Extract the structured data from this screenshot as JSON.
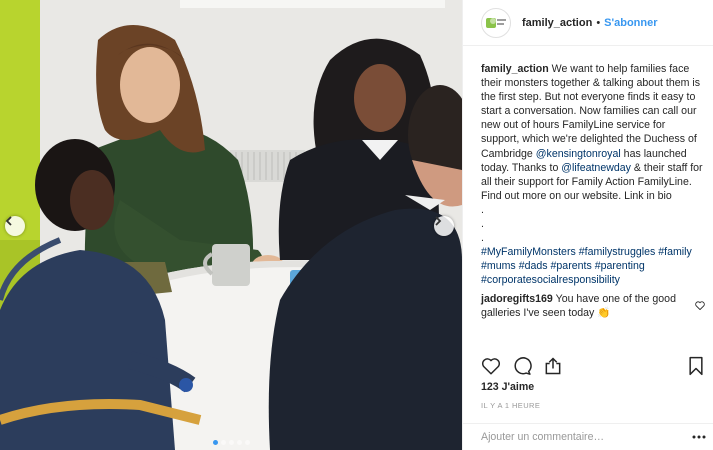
{
  "post": {
    "username": "family_action",
    "separator": "•",
    "follow_label": "S'abonner",
    "caption_author": "family_action",
    "caption_part1": " We want to help families face their monsters together & talking about them is the first step. But not everyone finds it easy to start a conversation. Now families can call our new out of hours FamilyLine service for support, which we're delighted the Duchess of Cambridge ",
    "mention_1": "@kensingtonroyal",
    "caption_part2": " has launched today. Thanks to ",
    "mention_2": "@lifeatnewday",
    "caption_part3": " & their staff for all their support for Family Action FamilyLine. Find out more on our website. Link in bio",
    "dots": ".\n.\n.",
    "hashtags": [
      "#MyFamilyMonsters",
      "#familystruggles",
      "#family",
      "#mums",
      "#dads",
      "#parents",
      "#parenting",
      "#corporatesocialresponsibility"
    ],
    "comment": {
      "author": "jadoregifts169",
      "text": " You have one of the good galleries I've seen today 👏"
    },
    "likes": "123 J'aime",
    "time": "IL Y A 1 HEURE",
    "comment_placeholder": "Ajouter un commentaire…"
  },
  "carousel": {
    "slide_count": 5,
    "active_index": 0
  },
  "icons": {
    "prev": "chevron-left-icon",
    "next": "chevron-right-icon",
    "like": "heart-icon",
    "comment": "comment-bubble-icon",
    "share": "share-icon",
    "save": "bookmark-icon",
    "more": "more-options-icon"
  },
  "colors": {
    "link": "#003569",
    "accent": "#3897f0",
    "muted": "#999999",
    "text": "#262626"
  }
}
